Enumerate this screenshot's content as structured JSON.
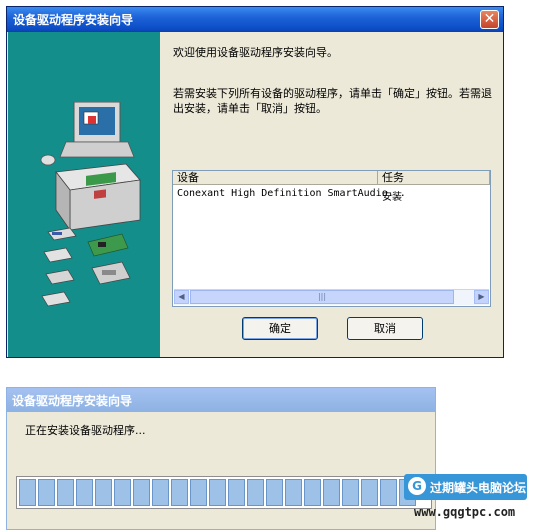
{
  "wizard": {
    "title": "设备驱动程序安装向导",
    "welcome": "欢迎使用设备驱动程序安装向导。",
    "instructions": "若需安装下列所有设备的驱动程序，请单击「确定」按钮。若需退出安装，请单击「取消」按钮。",
    "list": {
      "headers": [
        "设备",
        "任务"
      ],
      "rows": [
        {
          "device": "Conexant High Definition SmartAudio...",
          "task": "安装"
        }
      ],
      "scroll_left_icon": "chevron-left-icon",
      "scroll_right_icon": "chevron-right-icon"
    },
    "ok_label": "确定",
    "cancel_label": "取消",
    "accent_color": "#138e8a"
  },
  "progress_window": {
    "title": "设备驱动程序安装向导",
    "status": "正在安装设备驱动程序...",
    "progress_fraction": 1.0,
    "segment_color": "#9ec1e8"
  },
  "watermark": {
    "label": "过期罐头电脑论坛",
    "url": "www.gqgtpc.com"
  }
}
